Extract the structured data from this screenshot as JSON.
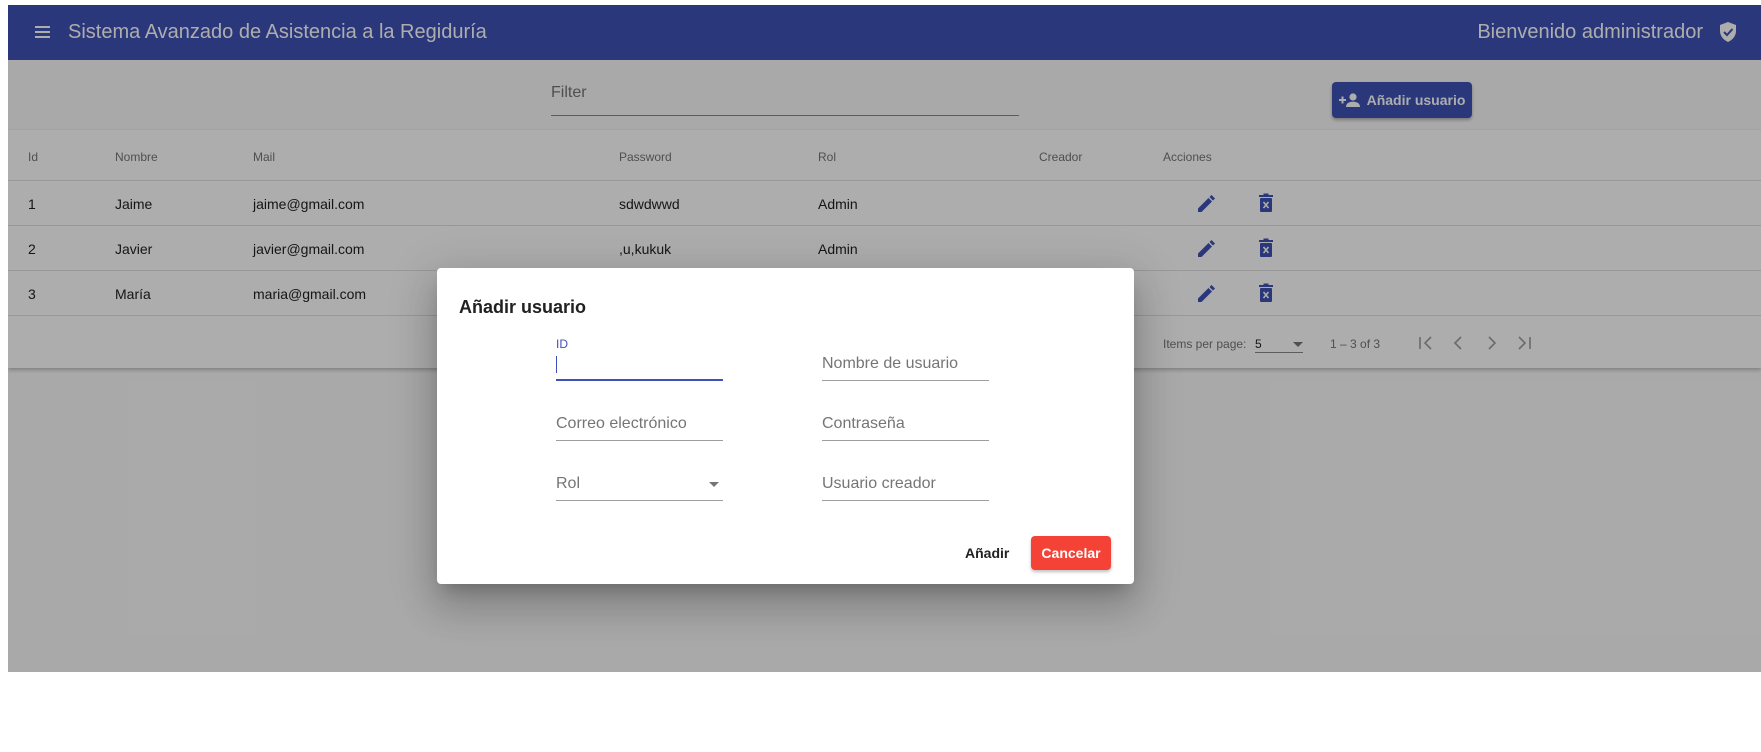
{
  "toolbar": {
    "menu_icon": "menu-icon",
    "title": "Sistema Avanzado de Asistencia a la Regiduría",
    "welcome": "Bienvenido administrador",
    "user_icon": "verified-shield-icon"
  },
  "filter": {
    "placeholder": "Filter",
    "value": ""
  },
  "add_user_button": {
    "label": "Añadir usuario",
    "icon": "person-add-icon"
  },
  "table": {
    "columns": [
      "Id",
      "Nombre",
      "Mail",
      "Password",
      "Rol",
      "Creador",
      "Acciones"
    ],
    "rows": [
      {
        "id": "1",
        "nombre": "Jaime",
        "mail": "jaime@gmail.com",
        "password": "sdwdwwd",
        "rol": "Admin",
        "creador": ""
      },
      {
        "id": "2",
        "nombre": "Javier",
        "mail": "javier@gmail.com",
        "password": ",u,kukuk",
        "rol": "Admin",
        "creador": ""
      },
      {
        "id": "3",
        "nombre": "María",
        "mail": "maria@gmail.com",
        "password": "",
        "rol": "",
        "creador": ""
      }
    ],
    "action_icons": [
      "edit-pencil-icon",
      "delete-trash-icon"
    ]
  },
  "paginator": {
    "items_per_page_label": "Items per page:",
    "page_size": "5",
    "range_label": "1 – 3 of 3"
  },
  "dialog": {
    "title": "Añadir usuario",
    "fields": {
      "id": {
        "label": "ID",
        "value": ""
      },
      "nombre": {
        "placeholder": "Nombre de usuario"
      },
      "correo": {
        "placeholder": "Correo electrónico"
      },
      "password": {
        "placeholder": "Contraseña"
      },
      "rol": {
        "placeholder": "Rol"
      },
      "creador": {
        "placeholder": "Usuario creador"
      }
    },
    "add_label": "Añadir",
    "cancel_label": "Cancelar"
  },
  "colors": {
    "primary": "#3f51b5",
    "warn": "#f44336"
  }
}
